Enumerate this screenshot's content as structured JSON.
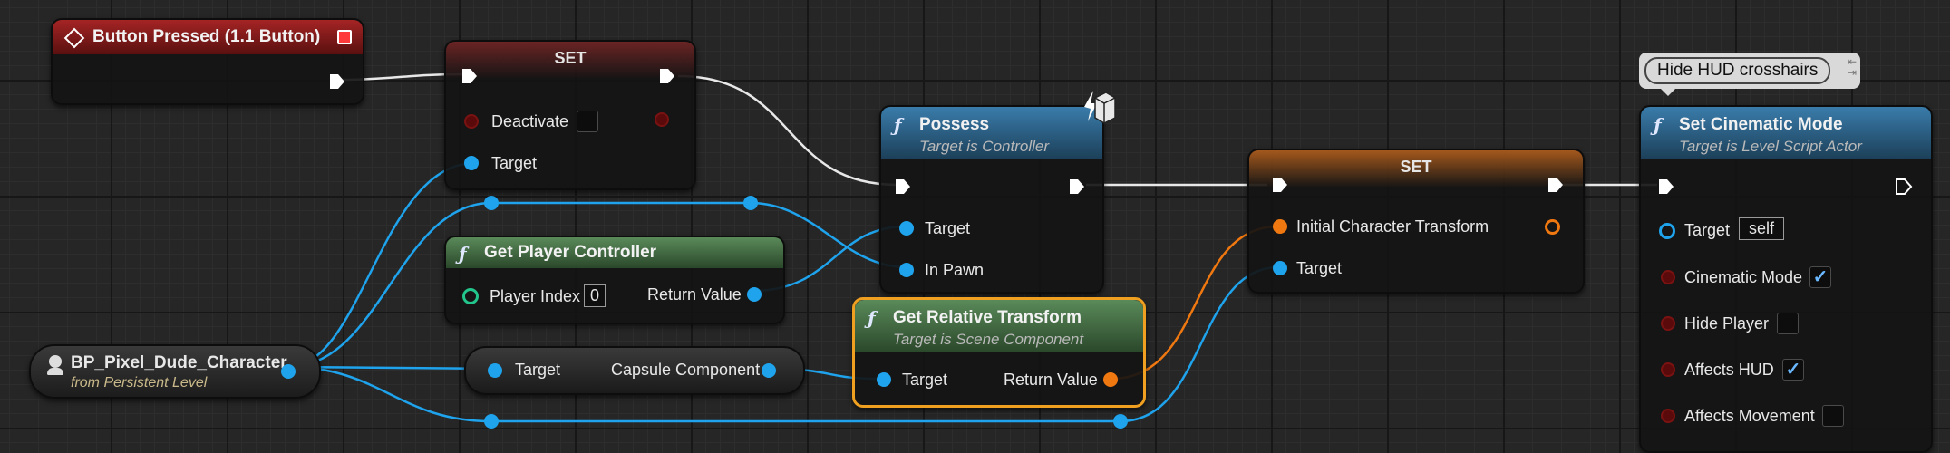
{
  "event_node": {
    "title": "Button Pressed (1.1 Button)"
  },
  "set_node_1": {
    "title": "SET",
    "pin_deactivate": "Deactivate",
    "pin_target": "Target"
  },
  "possess_node": {
    "title": "Possess",
    "subtitle": "Target is Controller",
    "pin_target": "Target",
    "pin_in_pawn": "In Pawn"
  },
  "get_player_controller": {
    "title": "Get Player Controller",
    "pin_player_index": "Player Index",
    "player_index_value": "0",
    "pin_return": "Return Value"
  },
  "character_ref": {
    "title": "BP_Pixel_Dude_Character",
    "subtitle": "from Persistent Level"
  },
  "capsule_node": {
    "pin_target": "Target",
    "pin_output": "Capsule Component"
  },
  "get_relative_transform": {
    "title": "Get Relative Transform",
    "subtitle": "Target is Scene Component",
    "pin_target": "Target",
    "pin_return": "Return Value"
  },
  "set_node_2": {
    "title": "SET",
    "pin_transform": "Initial Character Transform",
    "pin_target": "Target"
  },
  "comment_bubble": {
    "text": "Hide HUD crosshairs"
  },
  "cinematic_node": {
    "title": "Set Cinematic Mode",
    "subtitle": "Target is Level Script Actor",
    "pin_target": "Target",
    "target_value": "self",
    "pins": [
      {
        "label": "Cinematic Mode",
        "checked": true
      },
      {
        "label": "Hide Player",
        "checked": false
      },
      {
        "label": "Affects HUD",
        "checked": true
      },
      {
        "label": "Affects Movement",
        "checked": false
      }
    ]
  },
  "colors": {
    "exec": "#ffffff",
    "object": "#1ea3ec",
    "struct": "#f07810",
    "bool": "#7a1212",
    "int": "#22c58b",
    "event_header": "#8e1e1e",
    "function_header": "#2b5d80",
    "pure_header": "#3a6b3a"
  }
}
